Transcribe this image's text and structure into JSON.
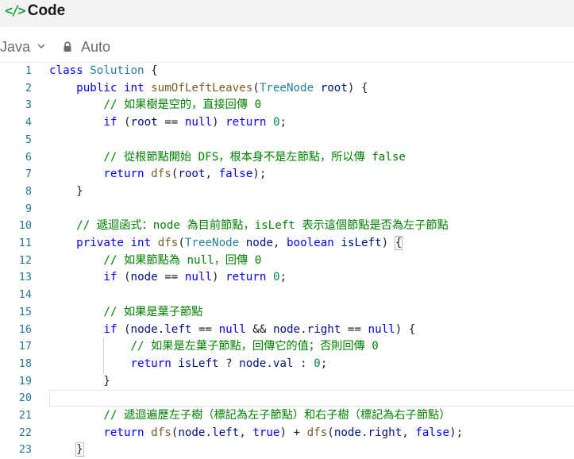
{
  "header": {
    "icon": "code-icon",
    "title": "Code"
  },
  "toolbar": {
    "language": "Java",
    "mode": "Auto"
  },
  "editor": {
    "current_line": 20,
    "lines": [
      {
        "no": "1",
        "tokens": [
          [
            "k",
            "class"
          ],
          [
            "p",
            " "
          ],
          [
            "t",
            "Solution"
          ],
          [
            "p",
            " {"
          ]
        ]
      },
      {
        "no": "2",
        "tokens": [
          [
            "p",
            "    "
          ],
          [
            "k",
            "public"
          ],
          [
            "p",
            " "
          ],
          [
            "k",
            "int"
          ],
          [
            "p",
            " "
          ],
          [
            "f",
            "sumOfLeftLeaves"
          ],
          [
            "p",
            "("
          ],
          [
            "t",
            "TreeNode"
          ],
          [
            "p",
            " "
          ],
          [
            "v",
            "root"
          ],
          [
            "p",
            ") {"
          ]
        ]
      },
      {
        "no": "3",
        "tokens": [
          [
            "p",
            "        "
          ],
          [
            "c",
            "// 如果樹是空的，直接回傳 0"
          ]
        ]
      },
      {
        "no": "4",
        "tokens": [
          [
            "p",
            "        "
          ],
          [
            "k",
            "if"
          ],
          [
            "p",
            " ("
          ],
          [
            "v",
            "root"
          ],
          [
            "p",
            " == "
          ],
          [
            "k",
            "null"
          ],
          [
            "p",
            ") "
          ],
          [
            "k",
            "return"
          ],
          [
            "p",
            " "
          ],
          [
            "n",
            "0"
          ],
          [
            "p",
            ";"
          ]
        ]
      },
      {
        "no": "5",
        "tokens": []
      },
      {
        "no": "6",
        "tokens": [
          [
            "p",
            "        "
          ],
          [
            "c",
            "// 從根節點開始 DFS，根本身不是左節點，所以傳 false"
          ]
        ]
      },
      {
        "no": "7",
        "tokens": [
          [
            "p",
            "        "
          ],
          [
            "k",
            "return"
          ],
          [
            "p",
            " "
          ],
          [
            "f",
            "dfs"
          ],
          [
            "p",
            "("
          ],
          [
            "v",
            "root"
          ],
          [
            "p",
            ", "
          ],
          [
            "k",
            "false"
          ],
          [
            "p",
            ");"
          ]
        ]
      },
      {
        "no": "8",
        "tokens": [
          [
            "p",
            "    }"
          ]
        ]
      },
      {
        "no": "9",
        "tokens": []
      },
      {
        "no": "10",
        "tokens": [
          [
            "p",
            "    "
          ],
          [
            "c",
            "// 遞迴函式：node 為目前節點，isLeft 表示這個節點是否為左子節點"
          ]
        ]
      },
      {
        "no": "11",
        "tokens": [
          [
            "p",
            "    "
          ],
          [
            "k",
            "private"
          ],
          [
            "p",
            " "
          ],
          [
            "k",
            "int"
          ],
          [
            "p",
            " "
          ],
          [
            "f",
            "dfs"
          ],
          [
            "p",
            "("
          ],
          [
            "t",
            "TreeNode"
          ],
          [
            "p",
            " "
          ],
          [
            "v",
            "node"
          ],
          [
            "p",
            ", "
          ],
          [
            "k",
            "boolean"
          ],
          [
            "p",
            " "
          ],
          [
            "v",
            "isLeft"
          ],
          [
            "p",
            ") "
          ],
          [
            "br",
            "{"
          ]
        ]
      },
      {
        "no": "12",
        "tokens": [
          [
            "p",
            "        "
          ],
          [
            "c",
            "// 如果節點為 null，回傳 0"
          ]
        ]
      },
      {
        "no": "13",
        "tokens": [
          [
            "p",
            "        "
          ],
          [
            "k",
            "if"
          ],
          [
            "p",
            " ("
          ],
          [
            "v",
            "node"
          ],
          [
            "p",
            " == "
          ],
          [
            "k",
            "null"
          ],
          [
            "p",
            ") "
          ],
          [
            "k",
            "return"
          ],
          [
            "p",
            " "
          ],
          [
            "n",
            "0"
          ],
          [
            "p",
            ";"
          ]
        ]
      },
      {
        "no": "14",
        "tokens": []
      },
      {
        "no": "15",
        "tokens": [
          [
            "p",
            "        "
          ],
          [
            "c",
            "// 如果是葉子節點"
          ]
        ]
      },
      {
        "no": "16",
        "tokens": [
          [
            "p",
            "        "
          ],
          [
            "k",
            "if"
          ],
          [
            "p",
            " ("
          ],
          [
            "v",
            "node"
          ],
          [
            "p",
            "."
          ],
          [
            "v",
            "left"
          ],
          [
            "p",
            " == "
          ],
          [
            "k",
            "null"
          ],
          [
            "p",
            " && "
          ],
          [
            "v",
            "node"
          ],
          [
            "p",
            "."
          ],
          [
            "v",
            "right"
          ],
          [
            "p",
            " == "
          ],
          [
            "k",
            "null"
          ],
          [
            "p",
            ") {"
          ]
        ]
      },
      {
        "no": "17",
        "tokens": [
          [
            "p",
            "            "
          ],
          [
            "c",
            "// 如果是左葉子節點，回傳它的值；否則回傳 0"
          ]
        ]
      },
      {
        "no": "18",
        "tokens": [
          [
            "p",
            "            "
          ],
          [
            "k",
            "return"
          ],
          [
            "p",
            " "
          ],
          [
            "v",
            "isLeft"
          ],
          [
            "p",
            " ? "
          ],
          [
            "v",
            "node"
          ],
          [
            "p",
            "."
          ],
          [
            "v",
            "val"
          ],
          [
            "p",
            " : "
          ],
          [
            "n",
            "0"
          ],
          [
            "p",
            ";"
          ]
        ]
      },
      {
        "no": "19",
        "tokens": [
          [
            "p",
            "        }"
          ]
        ]
      },
      {
        "no": "20",
        "tokens": []
      },
      {
        "no": "21",
        "tokens": [
          [
            "p",
            "        "
          ],
          [
            "c",
            "// 遞迴遍歷左子樹（標記為左子節點）和右子樹（標記為右子節點）"
          ]
        ]
      },
      {
        "no": "22",
        "tokens": [
          [
            "p",
            "        "
          ],
          [
            "k",
            "return"
          ],
          [
            "p",
            " "
          ],
          [
            "f",
            "dfs"
          ],
          [
            "p",
            "("
          ],
          [
            "v",
            "node"
          ],
          [
            "p",
            "."
          ],
          [
            "v",
            "left"
          ],
          [
            "p",
            ", "
          ],
          [
            "k",
            "true"
          ],
          [
            "p",
            ") + "
          ],
          [
            "f",
            "dfs"
          ],
          [
            "p",
            "("
          ],
          [
            "v",
            "node"
          ],
          [
            "p",
            "."
          ],
          [
            "v",
            "right"
          ],
          [
            "p",
            ", "
          ],
          [
            "k",
            "false"
          ],
          [
            "p",
            ");"
          ]
        ]
      },
      {
        "no": "23",
        "tokens": [
          [
            "p",
            "    "
          ],
          [
            "br",
            "}"
          ]
        ]
      }
    ]
  }
}
